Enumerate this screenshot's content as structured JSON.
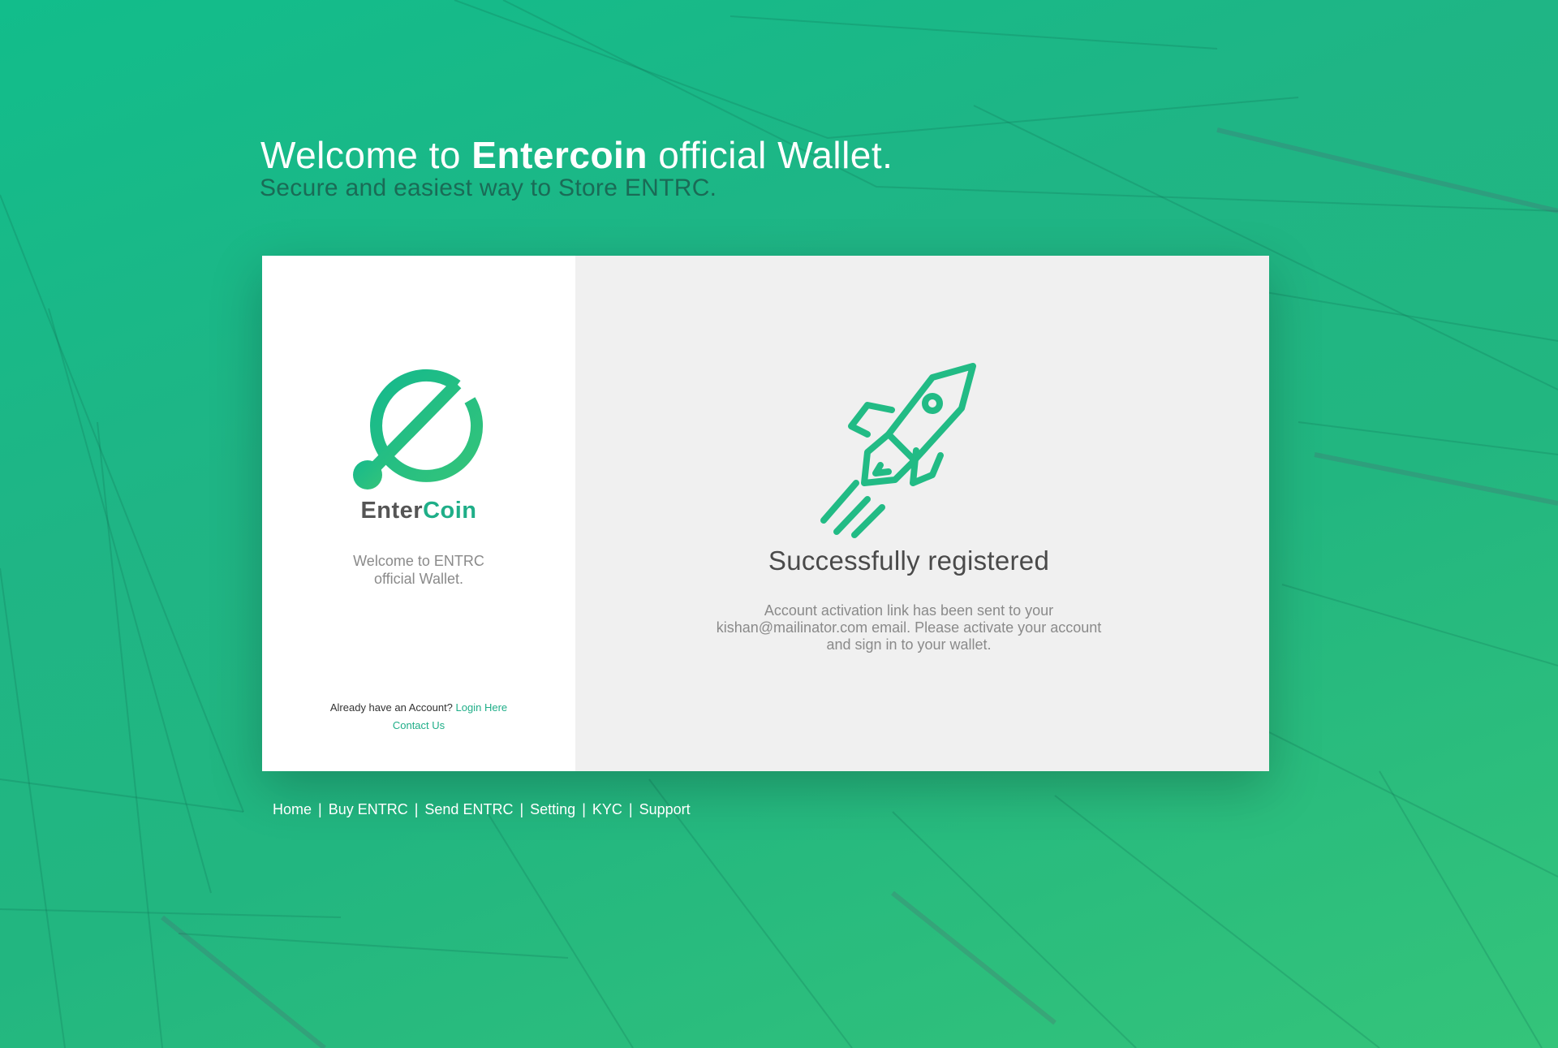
{
  "header": {
    "title_prefix": "Welcome to ",
    "title_brand": "Entercoin",
    "title_suffix": " official Wallet.",
    "subtitle": "Secure and easiest way to Store ENTRC."
  },
  "left_panel": {
    "logo_icon": "entercoin-logo",
    "brand_part1": "Enter",
    "brand_part2": "Coin",
    "welcome_line1": "Welcome to ENTRC",
    "welcome_line2": "official Wallet.",
    "account_prompt": "Already have an Account? ",
    "login_link": "Login Here",
    "contact_link": "Contact Us"
  },
  "right_panel": {
    "icon": "rocket-icon",
    "title": "Successfully registered",
    "message_line1": "Account activation link has been sent to your",
    "message_line2": "kishan@mailinator.com email. Please activate your account",
    "message_line3": "and sign in to your wallet."
  },
  "footer_nav": {
    "items": [
      "Home",
      "Buy ENTRC",
      "Send ENTRC",
      "Setting",
      "KYC",
      "Support"
    ],
    "separator": "|"
  },
  "colors": {
    "accent": "#1fae88",
    "background_green": "#1fb585",
    "panel_grey": "#f0f0f0"
  }
}
